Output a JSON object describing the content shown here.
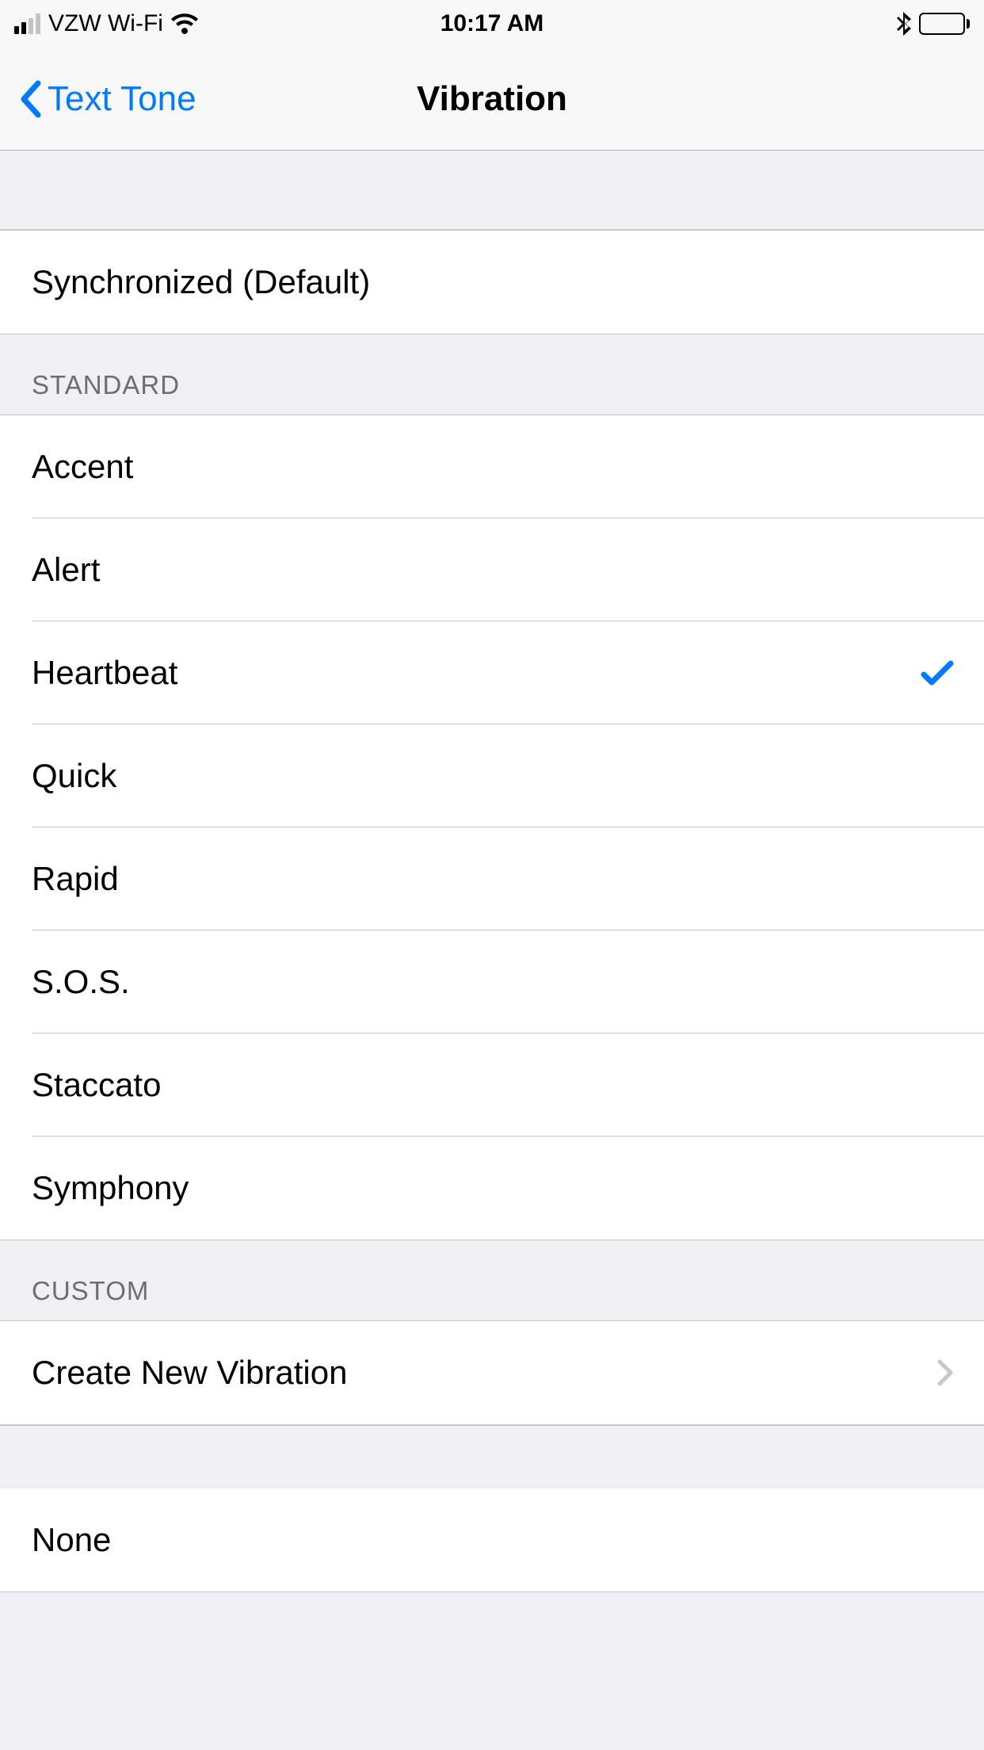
{
  "status": {
    "carrier": "VZW Wi-Fi",
    "time": "10:17 AM"
  },
  "nav": {
    "back_label": "Text Tone",
    "title": "Vibration"
  },
  "default_group": {
    "items": [
      {
        "label": "Synchronized (Default)",
        "selected": false
      }
    ]
  },
  "standard": {
    "header": "STANDARD",
    "items": [
      {
        "label": "Accent",
        "selected": false
      },
      {
        "label": "Alert",
        "selected": false
      },
      {
        "label": "Heartbeat",
        "selected": true
      },
      {
        "label": "Quick",
        "selected": false
      },
      {
        "label": "Rapid",
        "selected": false
      },
      {
        "label": "S.O.S.",
        "selected": false
      },
      {
        "label": "Staccato",
        "selected": false
      },
      {
        "label": "Symphony",
        "selected": false
      }
    ]
  },
  "custom": {
    "header": "CUSTOM",
    "items": [
      {
        "label": "Create New Vibration",
        "disclosure": true
      }
    ]
  },
  "none_group": {
    "items": [
      {
        "label": "None",
        "selected": false
      }
    ]
  },
  "colors": {
    "tint": "#007aff",
    "bg": "#efeff4",
    "separator": "#c8c7cc",
    "secondary_text": "#6d6d72"
  }
}
